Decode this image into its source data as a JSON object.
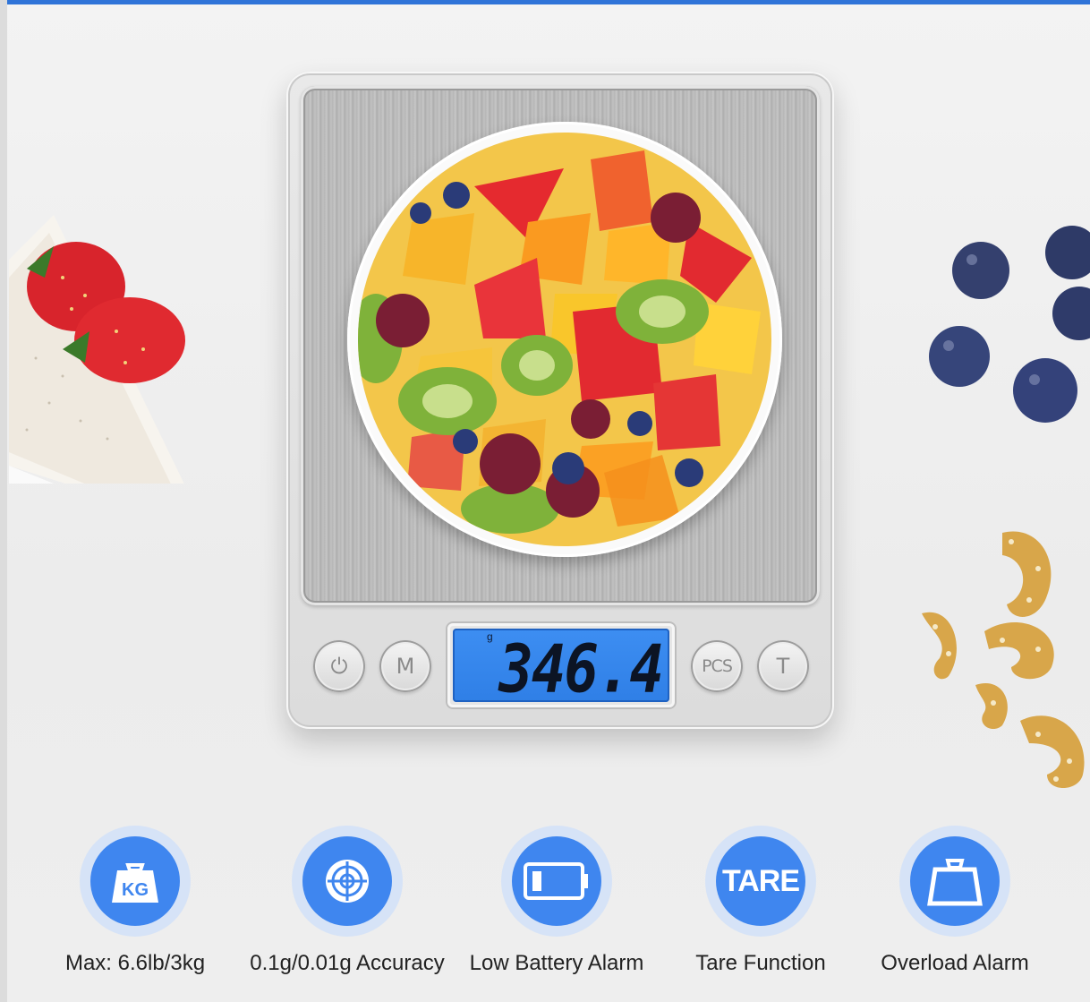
{
  "display": {
    "unit": "g",
    "reading": "346.4"
  },
  "buttons": {
    "power": "⏻",
    "mode": "M",
    "pieces": "PCS",
    "tare": "T"
  },
  "features": [
    {
      "icon": "weight-kg-icon",
      "icon_text": "KG",
      "label": "Max: 6.6lb/3kg"
    },
    {
      "icon": "crosshair-target-icon",
      "icon_text": "",
      "label": "0.1g/0.01g Accuracy"
    },
    {
      "icon": "battery-low-icon",
      "icon_text": "",
      "label": "Low Battery Alarm"
    },
    {
      "icon": "tare-icon",
      "icon_text": "TARE",
      "label": "Tare Function"
    },
    {
      "icon": "overload-weight-icon",
      "icon_text": "",
      "label": "Overload Alarm"
    }
  ],
  "colors": {
    "accent": "#3f86ef",
    "lcd": "#3d8ef2",
    "top_bar": "#2f74d8"
  }
}
